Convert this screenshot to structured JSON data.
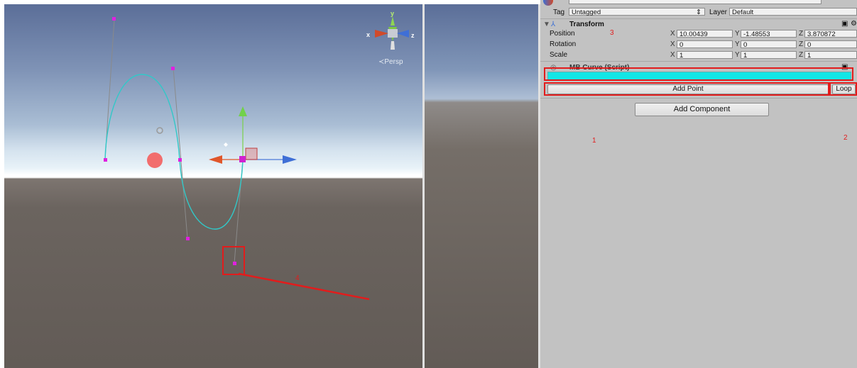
{
  "scene": {
    "persp_label": "≺Persp",
    "gizmo_y": "y",
    "gizmo_x": "x",
    "gizmo_z": "z"
  },
  "inspector": {
    "tag_label": "Tag",
    "tag_value": "Untagged",
    "layer_label": "Layer",
    "layer_value": "Default",
    "transform": {
      "title": "Transform",
      "position_label": "Position",
      "rotation_label": "Rotation",
      "scale_label": "Scale",
      "axis_x": "X",
      "axis_y": "Y",
      "axis_z": "Z",
      "position": {
        "x": "10.00439",
        "y": "-1.48553",
        "z": "3.870872"
      },
      "rotation": {
        "x": "0",
        "y": "0",
        "z": "0"
      },
      "scale": {
        "x": "1",
        "y": "1",
        "z": "1"
      }
    },
    "script": {
      "title": "MB Curve (Script)"
    },
    "add_point_label": "Add Point",
    "loop_label": "Loop",
    "add_component_label": "Add Component"
  },
  "annotations": {
    "n1": "1",
    "n2": "2",
    "n3": "3",
    "n4": "4"
  },
  "colors": {
    "curve": "#31c8c8",
    "handle": "#e020e0",
    "highlight": "#e21c1c",
    "bar": "#12e6e6"
  }
}
